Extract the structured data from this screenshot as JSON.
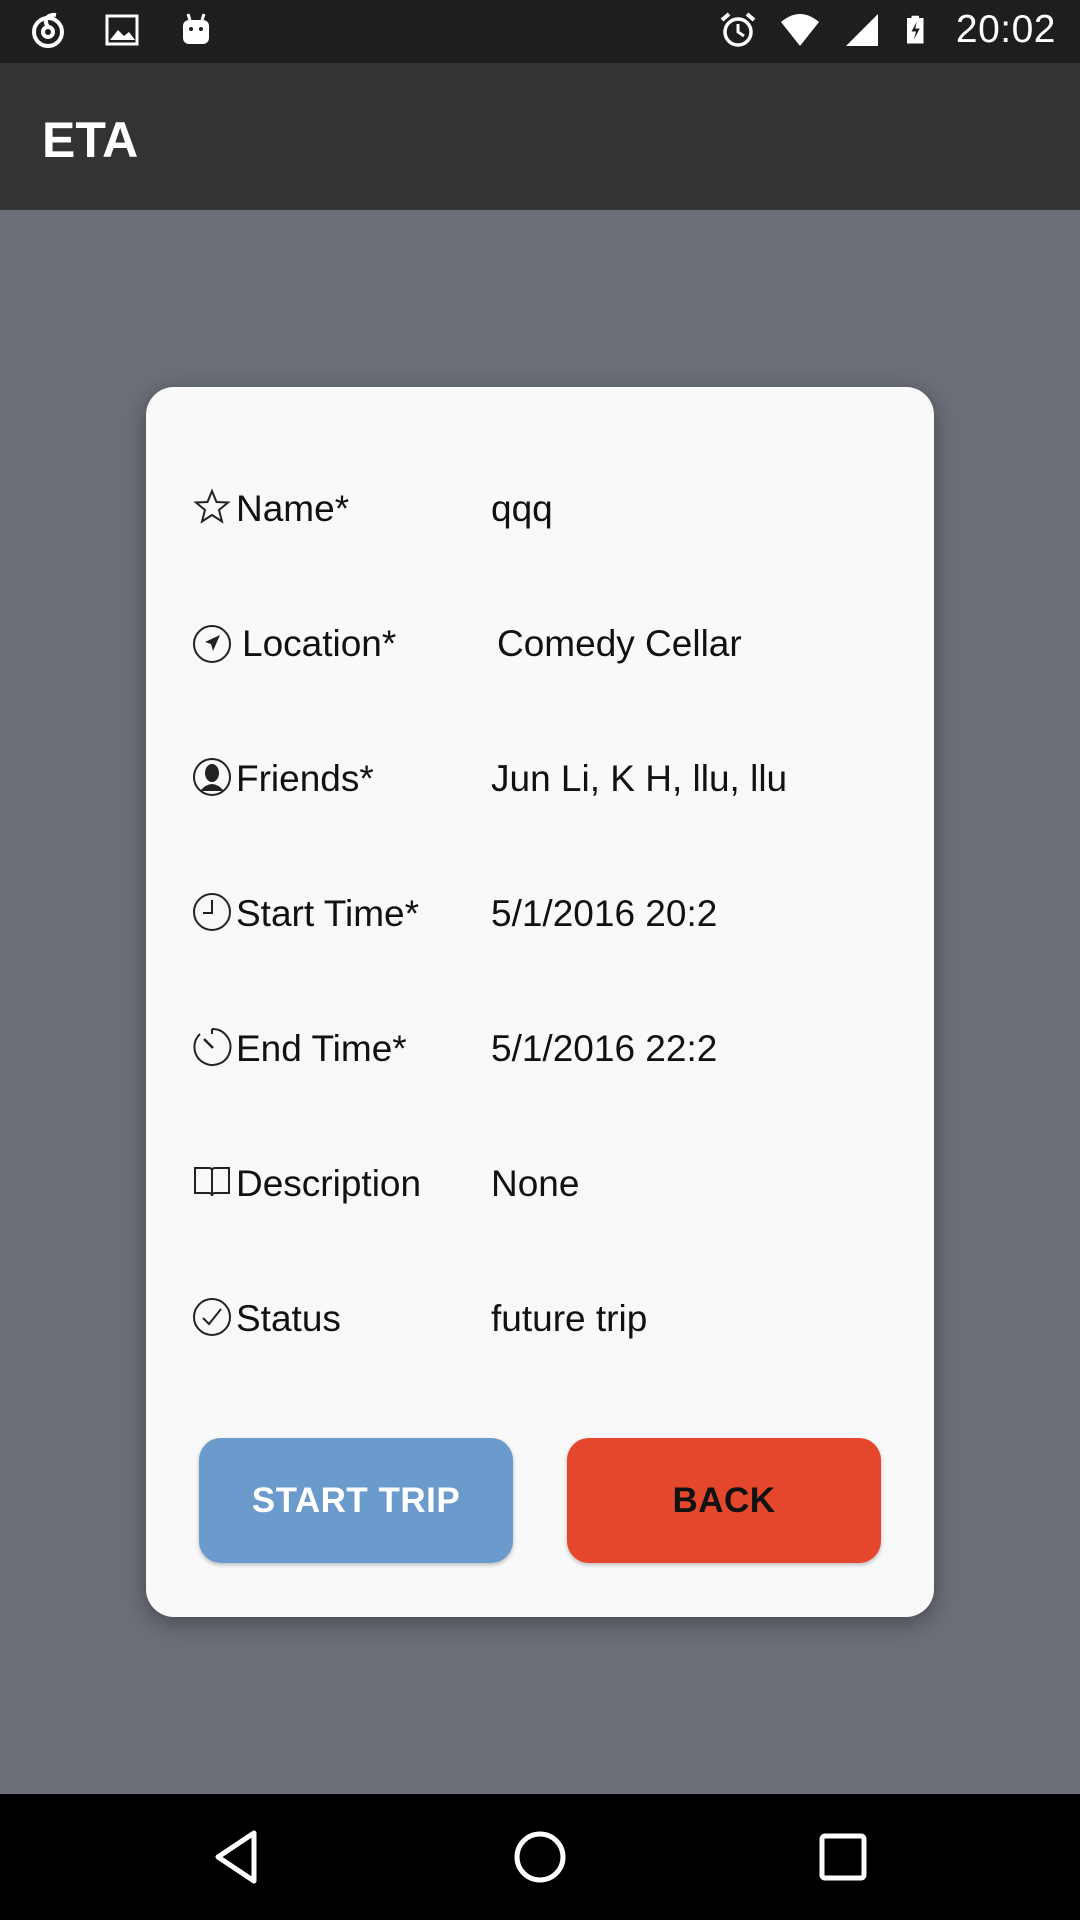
{
  "status_bar": {
    "time": "20:02",
    "left_icons": [
      "sync-icon",
      "image-icon",
      "android-icon"
    ],
    "right_icons": [
      "alarm-icon",
      "wifi-icon",
      "signal-icon",
      "battery-charging-icon"
    ]
  },
  "app_bar": {
    "title": "ETA",
    "background": "#333333"
  },
  "trip": {
    "fields": [
      {
        "icon": "star-icon",
        "label": "Name*",
        "value": "qqq"
      },
      {
        "icon": "location-arrow-icon",
        "label": "Location*",
        "value": "Comedy Cellar"
      },
      {
        "icon": "person-icon",
        "label": "Friends*",
        "value": "Jun Li, K H, llu, llu"
      },
      {
        "icon": "clock-icon",
        "label": "Start Time*",
        "value": "5/1/2016 20:2"
      },
      {
        "icon": "timer-icon",
        "label": "End Time*",
        "value": "5/1/2016 22:2"
      },
      {
        "icon": "book-icon",
        "label": "Description",
        "value": "None"
      },
      {
        "icon": "check-circle-icon",
        "label": "Status",
        "value": "future trip"
      }
    ]
  },
  "buttons": {
    "start_trip": "START TRIP",
    "back": "BACK",
    "start_color": "#6a9bcc",
    "back_color": "#e5472c"
  },
  "nav_bar": {
    "icons": [
      "back-triangle-icon",
      "home-circle-icon",
      "recents-square-icon"
    ]
  }
}
